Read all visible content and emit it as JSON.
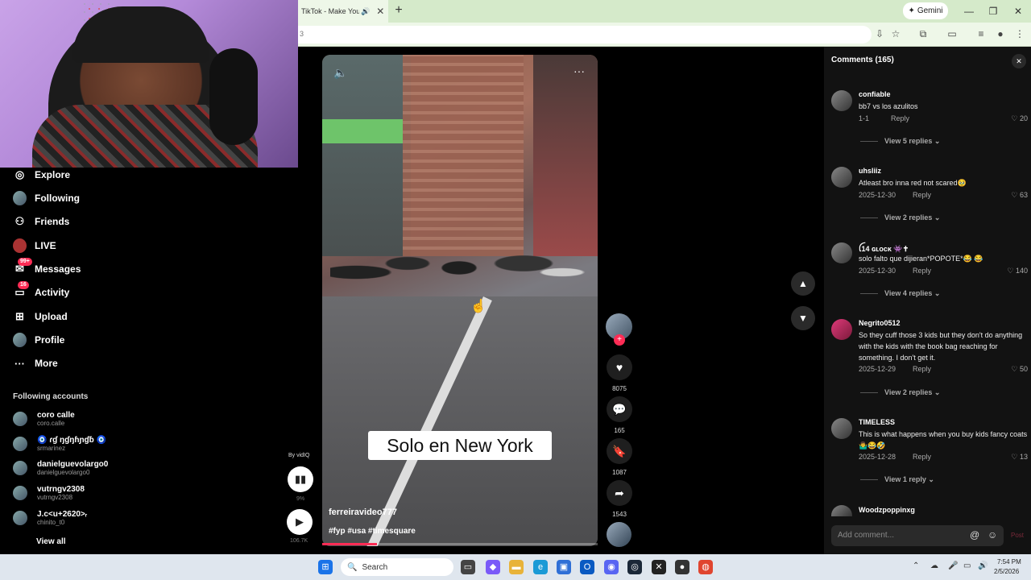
{
  "browser": {
    "tab_title": "TikTok - Make Your Da",
    "tab_close": "✕",
    "new_tab": "+",
    "gemini_label": "Gemini",
    "omnibox_value": "3",
    "win_min": "—",
    "win_max": "❐",
    "win_close": "✕"
  },
  "sidebar": {
    "items": [
      {
        "label": "Explore",
        "icon": "compass-icon",
        "glyph": "◎"
      },
      {
        "label": "Following",
        "icon": "following-avatar",
        "glyph": ""
      },
      {
        "label": "Friends",
        "icon": "friends-icon",
        "glyph": "👤"
      },
      {
        "label": "LIVE",
        "icon": "live-icon",
        "glyph": ""
      },
      {
        "label": "Messages",
        "icon": "messages-icon",
        "glyph": "✉",
        "badge": "99+"
      },
      {
        "label": "Activity",
        "icon": "activity-icon",
        "glyph": "⌂",
        "badge": "16"
      },
      {
        "label": "Upload",
        "icon": "upload-icon",
        "glyph": "⊞"
      },
      {
        "label": "Profile",
        "icon": "profile-avatar",
        "glyph": ""
      },
      {
        "label": "More",
        "icon": "more-icon",
        "glyph": "···"
      }
    ],
    "following_title": "Following accounts",
    "accounts": [
      {
        "name": "coro calle",
        "handle": "coro.calle"
      },
      {
        "name": "🧿 ɾɠ ŋɠŋɦɲɠɓ 🧿",
        "handle": "srmarinez"
      },
      {
        "name": "danielguevolargo0",
        "handle": "danielguevolargo0"
      },
      {
        "name": "vutrngv2308",
        "handle": "vutrngv2308"
      },
      {
        "name": "J.c<u+2620>ᵣ",
        "handle": "chinito_t0"
      }
    ],
    "view_all": "View all"
  },
  "video": {
    "caption": "Solo en New York",
    "author": "ferreiravideo777",
    "tags": "#fyp #usa #timesquare",
    "progress": 0.2,
    "more": "···"
  },
  "actions": {
    "likes": "8075",
    "comments": "165",
    "saves": "1087",
    "shares": "1543"
  },
  "vidiq": {
    "by": "By vidIQ",
    "pct": "9%",
    "views": "106.7K"
  },
  "comments_panel": {
    "title": "Comments (165)",
    "items": [
      {
        "user": "confiable",
        "text": "bb7 vs los azulitos",
        "date": "1-1",
        "reply": "Reply",
        "likes": "20",
        "view_replies": "View 5 replies"
      },
      {
        "user": "uhsliiz",
        "text": "Atleast bro inna red not scared🥹",
        "date": "2025-12-30",
        "reply": "Reply",
        "likes": "63",
        "view_replies": "View 2 replies"
      },
      {
        "user": "ꪶ14 ɢʟᴏᴄᴋ 👾✝",
        "text": "solo falto que dijieran*POPOTE*😂 😂",
        "date": "2025-12-30",
        "reply": "Reply",
        "likes": "140",
        "view_replies": "View 4 replies"
      },
      {
        "user": "Negrito0512",
        "text": "So they cuff those 3 kids but they don't do anything with the kids with the book bag reaching for something. I don't get it.",
        "date": "2025-12-29",
        "reply": "Reply",
        "likes": "50",
        "view_replies": "View 2 replies"
      },
      {
        "user": "TIMELESS",
        "text": "This is what happens when you buy kids fancy coats 🤷‍♂️😂🤣",
        "date": "2025-12-28",
        "reply": "Reply",
        "likes": "13",
        "view_replies": "View 1 reply"
      }
    ],
    "last_user": "Woodzpoppinxg",
    "add_placeholder": "Add comment...",
    "post": "Post"
  },
  "taskbar": {
    "search": "Search",
    "time": "7:54 PM",
    "date": "2/5/2026"
  },
  "colors": {
    "accent": "#fe2c55",
    "panel": "#121212",
    "chrome": "#d5eaca"
  }
}
